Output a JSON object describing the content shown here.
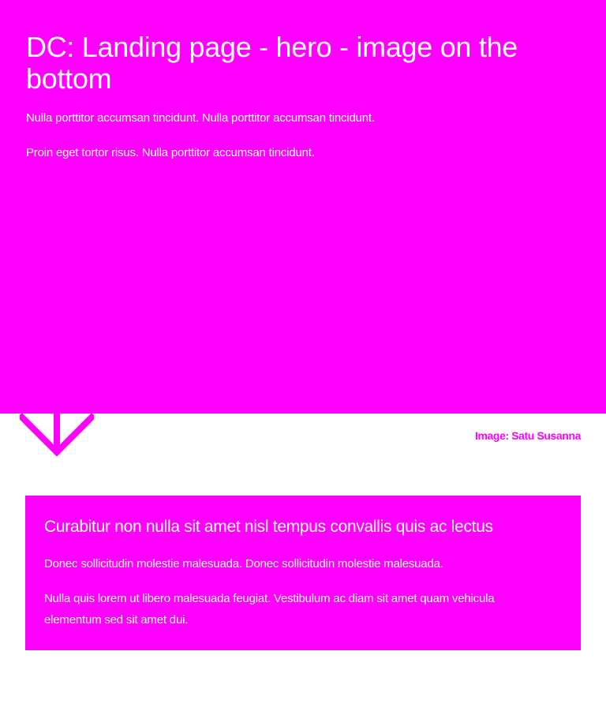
{
  "hero": {
    "title": "DC: Landing page - hero - image on the bottom",
    "paragraph_1": "Nulla porttitor accumsan tincidunt. Nulla porttitor accumsan tincidunt.",
    "paragraph_2": "Proin eget tortor risus. Nulla porttitor accumsan tincidunt.",
    "background_color": "#ff00ff",
    "text_color": "#ffffff"
  },
  "scroll_indicator": {
    "icon": "arrow-down-icon",
    "color": "#ff00ff"
  },
  "image_credit": {
    "text": "Image: Satu Susanna",
    "color": "#ff00ff"
  },
  "card": {
    "title": "Curabitur non nulla sit amet nisl tempus convallis quis ac lectus",
    "paragraph_1": "Donec sollicitudin molestie malesuada. Donec sollicitudin molestie malesuada.",
    "paragraph_2": "Nulla quis lorem ut libero malesuada feugiat. Vestibulum ac diam sit amet quam vehicula elementum sed sit amet dui.",
    "background_color": "#ff00ff"
  }
}
